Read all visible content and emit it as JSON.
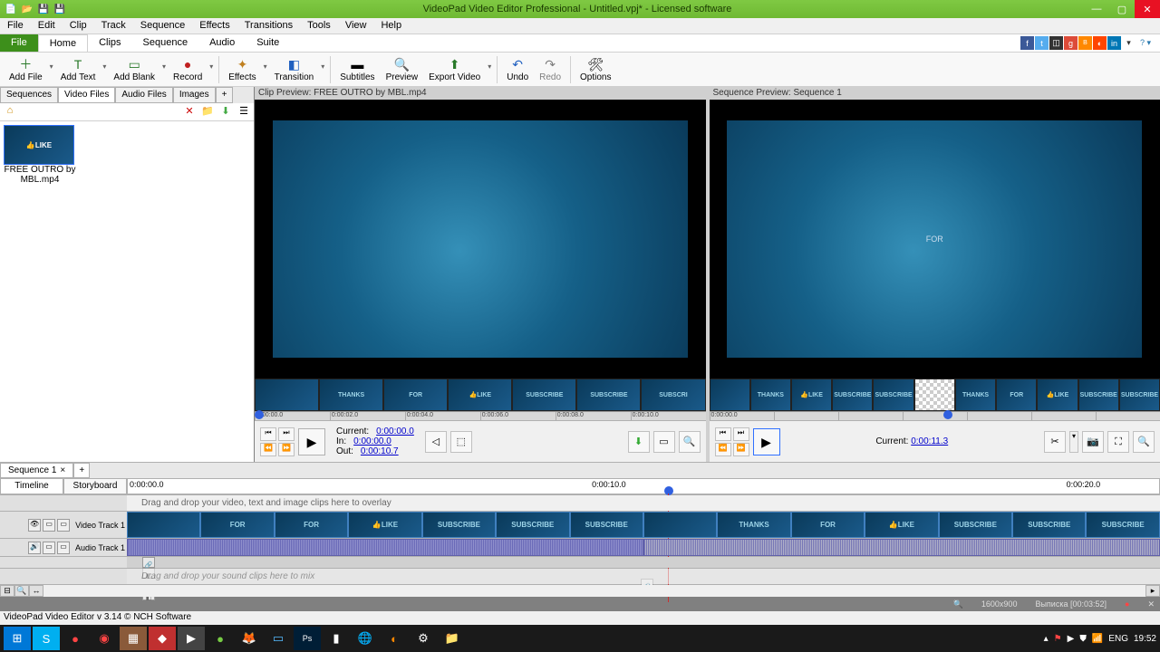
{
  "title": "VideoPad Video Editor Professional - Untitled.vpj* - Licensed software",
  "menu": [
    "File",
    "Edit",
    "Clip",
    "Track",
    "Sequence",
    "Effects",
    "Transitions",
    "Tools",
    "View",
    "Help"
  ],
  "ribbon_tabs": [
    "File",
    "Home",
    "Clips",
    "Sequence",
    "Audio",
    "Suite"
  ],
  "toolbar": {
    "add_file": "Add File",
    "add_text": "Add Text",
    "add_blank": "Add Blank",
    "record": "Record",
    "effects": "Effects",
    "transition": "Transition",
    "subtitles": "Subtitles",
    "preview": "Preview",
    "export_video": "Export Video",
    "undo": "Undo",
    "redo": "Redo",
    "options": "Options"
  },
  "file_tabs": [
    "Sequences",
    "Video Files",
    "Audio Files",
    "Images",
    "+"
  ],
  "file_item": {
    "name": "FREE OUTRO by MBL.mp4",
    "thumb": "👍LIKE"
  },
  "clip_preview": {
    "header": "Clip Preview: FREE OUTRO by MBL.mp4",
    "current_label": "Current:",
    "current": "0:00:00.0",
    "in_label": "In:",
    "in": "0:00:00.0",
    "out_label": "Out:",
    "out": "0:00:10.7",
    "ruler": [
      "0:00:00.0",
      "0:00:02.0",
      "0:00:04.0",
      "0:00:06.0",
      "0:00:08.0",
      "0:00:10.0"
    ],
    "frames": [
      "",
      "THANKS",
      "FOR",
      "👍LIKE",
      "SUBSCRIBE",
      "SUBSCRIBE",
      "SUBSCRI"
    ]
  },
  "seq_preview": {
    "header": "Sequence Preview: Sequence 1",
    "current_label": "Current:",
    "current": "0:00:11.3",
    "ruler": [
      "0:00:00.0",
      "",
      "",
      "",
      "",
      "",
      ""
    ],
    "frames": [
      "",
      "THANKS",
      "👍LIKE",
      "SUBSCRIBE",
      "SUBSCRIBE",
      "",
      "THANKS",
      "FOR",
      "👍LIKE",
      "SUBSCRIBE",
      "SUBSCRIBE"
    ]
  },
  "seq_tab": "Sequence 1",
  "tl_tabs": {
    "timeline": "Timeline",
    "storyboard": "Storyboard"
  },
  "tl_ruler": {
    "t0": "0:00:00.0",
    "t10": "0:00:10.0",
    "t20": "0:00:20.0"
  },
  "overlay_hint": "Drag and drop your video, text and image clips here to overlay",
  "sound_hint": "Drag and drop your sound clips here to mix",
  "video_track_label": "Video Track 1",
  "audio_track_label": "Audio Track 1",
  "vt_frames": [
    "",
    "FOR",
    "FOR",
    "👍LIKE",
    "SUBSCRIBE",
    "SUBSCRIBE",
    "SUBSCRIBE",
    "",
    "THANKS",
    "FOR",
    "👍LIKE",
    "SUBSCRIBE",
    "SUBSCRIBE",
    "SUBSCRIBE"
  ],
  "status_dark": {
    "res": "1600x900",
    "seq": "Выписка [00:03:52]"
  },
  "status_light": "VideoPad Video Editor v 3.14 © NCH Software",
  "tray": {
    "lang": "ENG",
    "time": "19:52"
  }
}
